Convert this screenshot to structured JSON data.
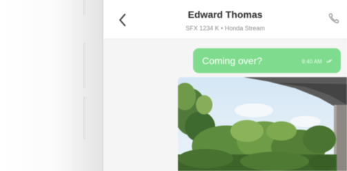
{
  "header": {
    "contact_name": "Edward Thomas",
    "contact_subtitle": "SFX 1234 K • Honda Stream",
    "back_icon": "chevron-left-icon",
    "call_icon": "phone-icon"
  },
  "messages": [
    {
      "text": "Coming over?",
      "time": "9:40 AM",
      "status_icon": "double-check-icon",
      "sender": "self"
    },
    {
      "type": "image",
      "sender": "other"
    }
  ],
  "colors": {
    "outgoing_bubble": "#7fdc8e",
    "header_bg": "#ffffff",
    "screen_bg": "#f5f5f5"
  }
}
